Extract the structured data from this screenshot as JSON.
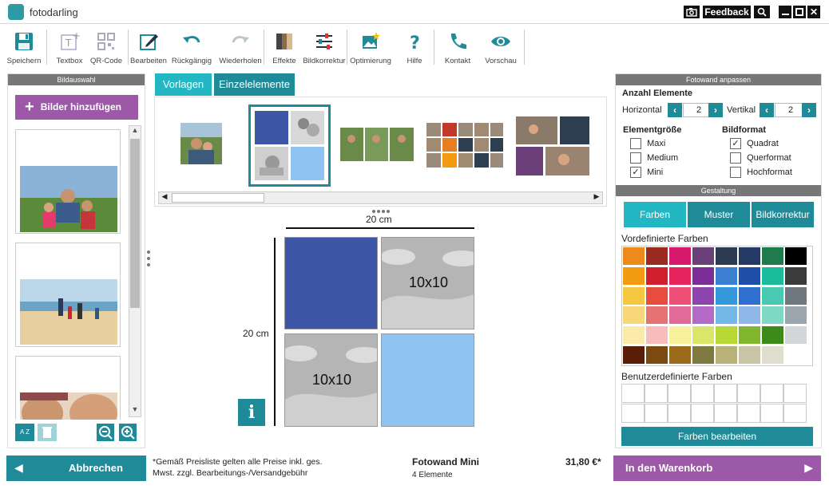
{
  "app": {
    "title": "fotodarling"
  },
  "titlebar": {
    "feedback": "Feedback"
  },
  "toolbar": {
    "items": [
      {
        "label": "Speichern"
      },
      {
        "label": "Textbox"
      },
      {
        "label": "QR-Code"
      },
      {
        "label": "Bearbeiten"
      },
      {
        "label": "Rückgängig"
      },
      {
        "label": "Wiederholen"
      },
      {
        "label": "Effekte"
      },
      {
        "label": "Bildkorrektur"
      },
      {
        "label": "Optimierung"
      },
      {
        "label": "Hilfe"
      },
      {
        "label": "Kontakt"
      },
      {
        "label": "Vorschau"
      }
    ]
  },
  "left": {
    "header": "Bildauswahl",
    "add_button": "Bilder hinzufügen",
    "sort_label": "A Z"
  },
  "tabs": {
    "vorlagen": "Vorlagen",
    "einzelelemente": "Einzelelemente"
  },
  "canvas": {
    "width_label": "20 cm",
    "height_label": "20 cm",
    "tile_label_1": "10x10",
    "tile_label_2": "10x10",
    "info": "i"
  },
  "right": {
    "header": "Fotowand anpassen",
    "anzahl_title": "Anzahl Elemente",
    "horizontal_label": "Horizontal",
    "horizontal_value": "2",
    "vertikal_label": "Vertikal",
    "vertikal_value": "2",
    "size_title": "Elementgröße",
    "sizes": [
      {
        "label": "Maxi",
        "checked": false
      },
      {
        "label": "Medium",
        "checked": false
      },
      {
        "label": "Mini",
        "checked": true
      }
    ],
    "format_title": "Bildformat",
    "formats": [
      {
        "label": "Quadrat",
        "checked": true
      },
      {
        "label": "Querformat",
        "checked": false
      },
      {
        "label": "Hochformat",
        "checked": false
      }
    ],
    "gestaltung_header": "Gestaltung",
    "gestaltung_tabs": [
      "Farben",
      "Muster",
      "Bildkorrektur"
    ],
    "predefined_title": "Vordefinierte Farben",
    "custom_title": "Benutzerdefinierte Farben",
    "edit_colors_button": "Farben bearbeiten",
    "palette": [
      "#ee8a1c",
      "#9b2a20",
      "#d6196a",
      "#6b3f78",
      "#2d3b52",
      "#233a66",
      "#1f7a4c",
      "#000000",
      "#f39c12",
      "#d21f2f",
      "#e8245f",
      "#7b2e98",
      "#3b7fd0",
      "#1f4fa8",
      "#1abc9c",
      "#3b3b3b",
      "#f5c842",
      "#e74c3c",
      "#ef5078",
      "#8e44ad",
      "#3498db",
      "#2f6fcf",
      "#48c9b0",
      "#707880",
      "#f7d77a",
      "#e57373",
      "#e26a98",
      "#b46bc8",
      "#74b8e8",
      "#8fb7e8",
      "#7fd8c4",
      "#9aa5ad",
      "#fbeaaa",
      "#f8bcbc",
      "#f6f19a",
      "#d9e66a",
      "#b6d936",
      "#7fb62e",
      "#3d8a1a",
      "#d3d6d9",
      "#5a1e08",
      "#7a4a10",
      "#9a6a1a",
      "#7f7a40",
      "#b8b27a",
      "#c9c4a6",
      "#e0dfcf",
      "#ffffff"
    ]
  },
  "footer": {
    "cancel": "Abbrechen",
    "notice_line1": "*Gemäß Preisliste gelten alle Preise inkl. ges.",
    "notice_line2": "Mwst. zzgl. Bearbeitungs-/Versandgebühr",
    "product_name": "Fotowand Mini",
    "product_sub": "4 Elemente",
    "price": "31,80 €*",
    "cart": "In den Warenkorb"
  },
  "colors": {
    "teal": "#1f9aa5",
    "purple": "#9b59a8",
    "tile_blue": "#3c56a5",
    "tile_lightblue": "#8ec3f2"
  }
}
